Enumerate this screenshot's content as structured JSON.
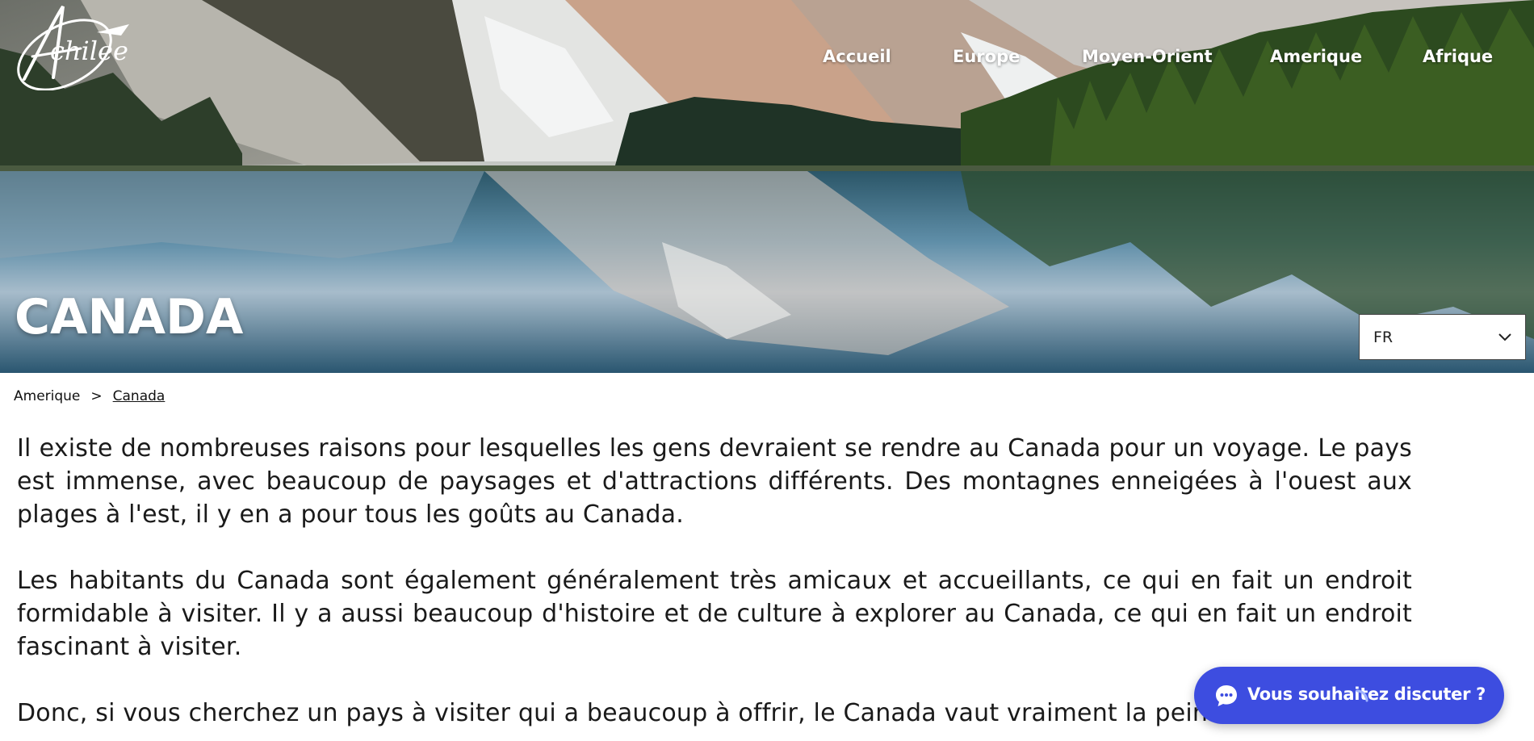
{
  "header": {
    "logo_text": "Achilee",
    "nav": [
      {
        "label": "Accueil"
      },
      {
        "label": "Europe"
      },
      {
        "label": "Moyen-Orient"
      },
      {
        "label": "Amerique"
      },
      {
        "label": "Afrique"
      }
    ]
  },
  "hero": {
    "title": "CANADA"
  },
  "language_select": {
    "value": "FR"
  },
  "breadcrumb": {
    "parent": "Amerique",
    "separator": ">",
    "current": "Canada"
  },
  "content": {
    "paragraphs": [
      "Il existe de nombreuses raisons pour lesquelles les gens devraient se rendre au Canada pour un voyage. Le pays est immense, avec beaucoup de paysages et d'attractions différents. Des montagnes enneigées à l'ouest aux plages à l'est, il y en a pour tous les goûts au Canada.",
      "Les habitants du Canada sont également généralement très amicaux et accueillants, ce qui en fait un endroit formidable à visiter. Il y a aussi beaucoup d'histoire et de culture à explorer au Canada, ce qui en fait un endroit fascinant à visiter.",
      "Donc, si vous cherchez un pays à visiter qui a beaucoup à offrir, le Canada vaut vraiment la peine d'être visité."
    ]
  },
  "chat": {
    "label": "Vous souhaitez discuter ?",
    "icon": "chat-bubble-icon",
    "color": "#3d4de0"
  },
  "colors": {
    "chat_button": "#3d4de0",
    "nav_text": "#ffffff",
    "body_text": "#1a1a1a"
  }
}
